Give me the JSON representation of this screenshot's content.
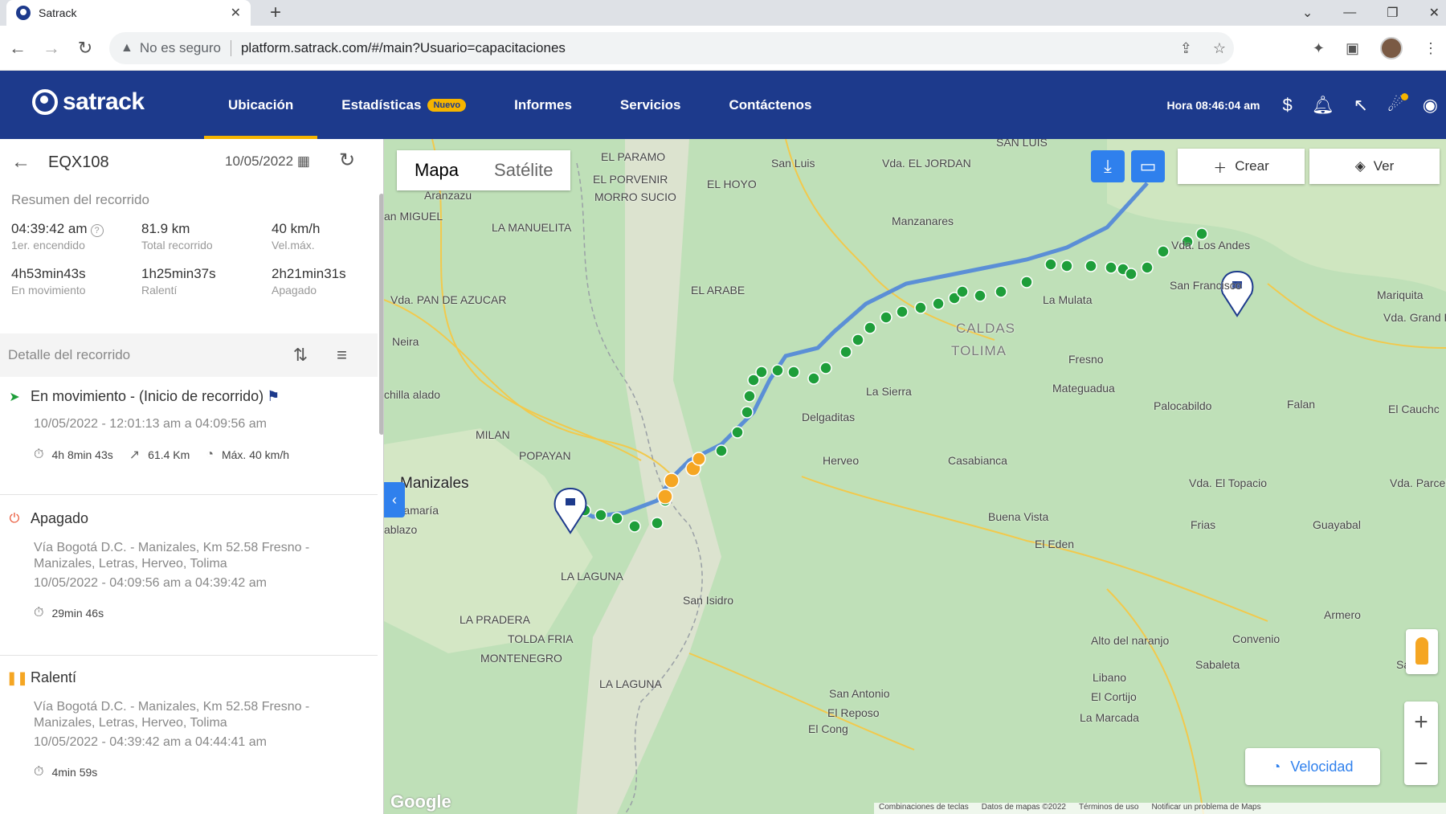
{
  "browser": {
    "tab_title": "Satrack",
    "insecure_label": "No es seguro",
    "url": "platform.satrack.com/#/main?Usuario=capacitaciones"
  },
  "app": {
    "logo": "satrack",
    "nav": [
      {
        "label": "Ubicación",
        "active": true
      },
      {
        "label": "Estadísticas",
        "badge": "Nuevo"
      },
      {
        "label": "Informes"
      },
      {
        "label": "Servicios"
      },
      {
        "label": "Contáctenos"
      }
    ],
    "clock": "Hora 08:46:04 am",
    "colors": {
      "header": "#1d3a8c",
      "accent": "#f5b400",
      "blue": "#2f80ed",
      "route": "#1e9e3a",
      "idle": "#f5a623"
    }
  },
  "panel": {
    "vehicle": "EQX108",
    "date": "10/05/2022",
    "summary_title": "Resumen del recorrido",
    "stats": [
      {
        "value": "04:39:42 am",
        "label": "1er. encendido"
      },
      {
        "value": "81.9 km",
        "label": "Total recorrido"
      },
      {
        "value": "40 km/h",
        "label": "Vel.máx."
      },
      {
        "value": "4h53min43s",
        "label": "En movimiento"
      },
      {
        "value": "1h25min37s",
        "label": "Ralentí"
      },
      {
        "value": "2h21min31s",
        "label": "Apagado"
      }
    ],
    "detail_title": "Detalle del recorrido",
    "events": [
      {
        "title": "En movimiento - (Inicio de recorrido)",
        "time": "10/05/2022 - 12:01:13 am a 04:09:56 am",
        "duration": "4h 8min 43s",
        "distance": "61.4 Km",
        "max_speed": "Máx. 40 km/h"
      },
      {
        "title": "Apagado",
        "address1": "Vía Bogotá D.C. - Manizales, Km 52.58 Fresno -",
        "address2": "Manizales, Letras, Herveo, Tolima",
        "time": "10/05/2022 - 04:09:56 am a 04:39:42 am",
        "duration": "29min 46s"
      },
      {
        "title": "Ralentí",
        "address1": "Vía Bogotá D.C. - Manizales, Km 52.58 Fresno -",
        "address2": "Manizales, Letras, Herveo, Tolima",
        "time": "10/05/2022 - 04:39:42 am a 04:44:41 am",
        "duration": "4min 59s"
      }
    ]
  },
  "map": {
    "type_map": "Mapa",
    "type_satellite": "Satélite",
    "create_label": "Crear",
    "view_label": "Ver",
    "speed_label": "Velocidad",
    "google": "Google",
    "attribution": [
      "Combinaciones de teclas",
      "Datos de mapas ©2022",
      "Términos de uso",
      "Notificar un problema de Maps"
    ],
    "places": [
      "SAN LUIS",
      "EL PARAMO",
      "San Luis",
      "Vda. EL JORDAN",
      "EL PORVENIR",
      "EL HOYO",
      "MORRO SUCIO",
      "Aranzazu",
      "an MIGUEL",
      "LA MANUELITA",
      "Manzanares",
      "Vda. Los Andes",
      "San Francisco",
      "Mariquita",
      "EL ARABE",
      "La Mulata",
      "Vda. Grand Pantano",
      "Vda. PAN DE AZUCAR",
      "Neira",
      "CALDAS",
      "TOLIMA",
      "Fresno",
      "Mateguadua",
      "Palocabildo",
      "Falan",
      "chilla alado",
      "La Sierra",
      "Delgaditas",
      "El Cauchc",
      "MILAN",
      "POPAYAN",
      "Herveo",
      "Casabianca",
      "Manizales",
      "Villamaría",
      "ablazo",
      "Vda. El Topacio",
      "Vda. Parcelacic Incora",
      "Buena Vista",
      "Frias",
      "Guayabal",
      "El Eden",
      "LA LAGUNA",
      "San Isidro",
      "LA PRADERA",
      "TOLDA FRIA",
      "MONTENEGRO",
      "Armero",
      "Convenio",
      "Alto del naranjo",
      "Sabaleta",
      "Libano",
      "San",
      "LA LAGUNA",
      "San Antonio",
      "El Cortijo",
      "El Reposo",
      "La Marcada",
      "El Cong"
    ]
  }
}
